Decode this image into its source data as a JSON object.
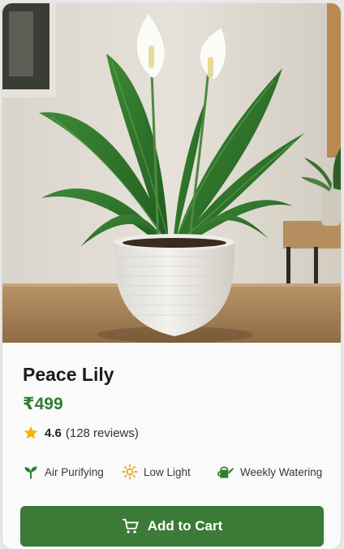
{
  "product": {
    "name": "Peace Lily",
    "price": "₹499",
    "rating_value": "4.6",
    "rating_count": "(128 reviews)",
    "features": [
      {
        "icon": "sprout-icon",
        "label": "Air Purifying"
      },
      {
        "icon": "sun-icon",
        "label": "Low Light"
      },
      {
        "icon": "watering-can-icon",
        "label": "Weekly Watering"
      }
    ],
    "cta_label": "Add to Cart",
    "cta_icon": "cart-icon"
  },
  "colors": {
    "accent_green": "#2f7d32",
    "button_green": "#3b7b37",
    "star": "#f4b400"
  }
}
